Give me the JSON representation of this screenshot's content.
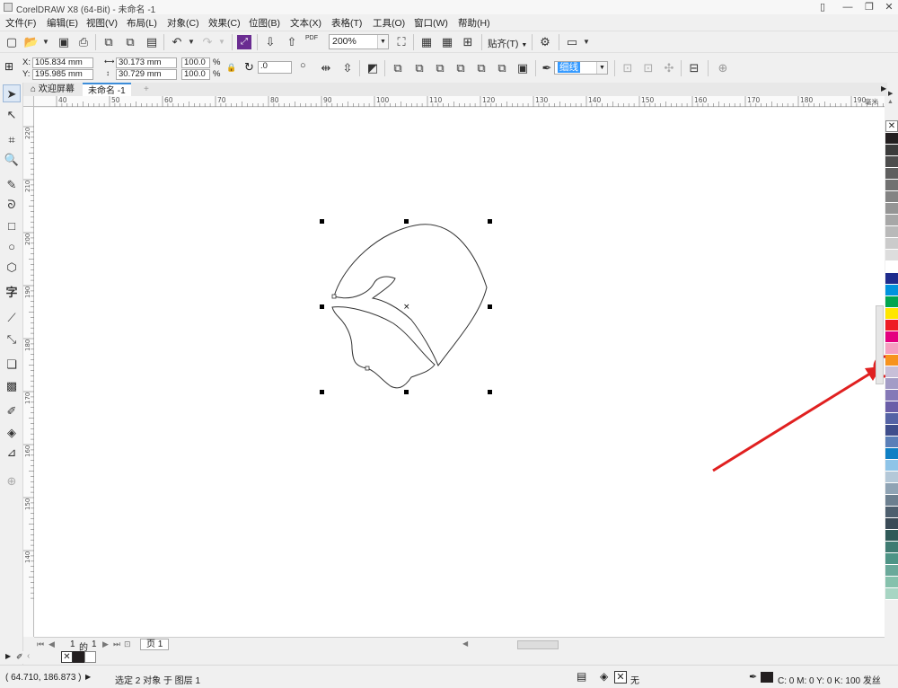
{
  "window": {
    "title": "CorelDRAW X8 (64-Bit) - 未命名 -1"
  },
  "menu": [
    "文件(F)",
    "编辑(E)",
    "视图(V)",
    "布局(L)",
    "对象(C)",
    "效果(C)",
    "位图(B)",
    "文本(X)",
    "表格(T)",
    "工具(O)",
    "窗口(W)",
    "帮助(H)"
  ],
  "toolbar": {
    "zoom": "200%",
    "snap_label": "贴齐(T)",
    "pdf_label": "PDF"
  },
  "propbar": {
    "x_label": "X:",
    "x_value": "105.834 mm",
    "y_label": "Y:",
    "y_value": "195.985 mm",
    "width_value": "30.173 mm",
    "height_value": "30.729 mm",
    "scale_x": "100.0",
    "scale_y": "100.0",
    "percent": "%",
    "rotation": ".0",
    "outline_width": "细线"
  },
  "tabs": {
    "welcome": "欢迎屏幕",
    "document": "未命名 -1"
  },
  "rulers": {
    "h_ticks": [
      "40",
      "50",
      "60",
      "70",
      "80",
      "90",
      "100",
      "110",
      "120",
      "130",
      "140",
      "150",
      "160",
      "170",
      "180",
      "190"
    ],
    "h_unit": "毫米",
    "v_ticks": [
      "220",
      "210",
      "200",
      "190",
      "180",
      "170",
      "160",
      "150",
      "140"
    ]
  },
  "pagenav": {
    "current": "1",
    "of": "的",
    "total": "1",
    "page_tab": "页 1"
  },
  "status": {
    "coords": "( 64.710, 186.873 )",
    "selection": "选定 2 对象 于 图层 1",
    "fill_none": "无",
    "outline_info": "C: 0 M: 0 Y: 0 K: 100  发丝"
  },
  "colors": {
    "accent_red": "#e02020",
    "palette": [
      "#231f20",
      "#3b3b3b",
      "#4d4d4d",
      "#5f5f5f",
      "#717171",
      "#838383",
      "#959595",
      "#a7a7a7",
      "#b9b9b9",
      "#cbcbcb",
      "#dddddd",
      "#ffffff",
      "#1e2b8c",
      "#0093dd",
      "#00a650",
      "#ffe600",
      "#ee1c25",
      "#e4007f",
      "#f5a0c0",
      "#f7931d",
      "#c8bfd8",
      "#a39cc6",
      "#8579b7",
      "#6a5ea8",
      "#5563a5",
      "#3f4e8c",
      "#5a7fb8",
      "#0e7fc4",
      "#8ec4e8",
      "#b4c8d8",
      "#8fa3b4",
      "#6c7f8f",
      "#4e5f6e",
      "#3a4a56",
      "#2f5a58",
      "#3f7b72",
      "#4e9486",
      "#6aa99a",
      "#85c1ac",
      "#a7d5c3"
    ]
  }
}
